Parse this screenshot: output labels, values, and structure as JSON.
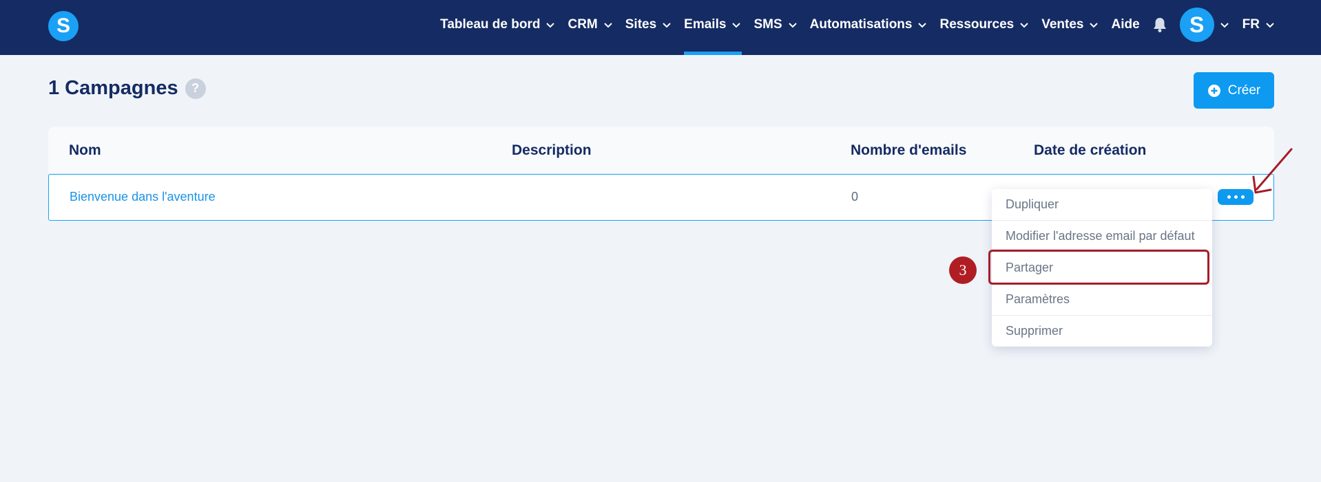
{
  "nav": {
    "logo_letter": "S",
    "items": [
      {
        "label": "Tableau de bord",
        "has_dropdown": true
      },
      {
        "label": "CRM",
        "has_dropdown": true
      },
      {
        "label": "Sites",
        "has_dropdown": true
      },
      {
        "label": "Emails",
        "has_dropdown": true,
        "active": true
      },
      {
        "label": "SMS",
        "has_dropdown": true
      },
      {
        "label": "Automatisations",
        "has_dropdown": true
      },
      {
        "label": "Ressources",
        "has_dropdown": true
      },
      {
        "label": "Ventes",
        "has_dropdown": true
      },
      {
        "label": "Aide",
        "has_dropdown": false
      }
    ],
    "avatar_letter": "S",
    "language": "FR"
  },
  "page": {
    "title": "1 Campagnes",
    "help_symbol": "?",
    "create_label": "Créer"
  },
  "table": {
    "columns": [
      "Nom",
      "Description",
      "Nombre d'emails",
      "Date de création"
    ],
    "rows": [
      {
        "name": "Bienvenue dans l'aventure",
        "description": "",
        "email_count": "0",
        "created": ""
      }
    ]
  },
  "menu": {
    "items": [
      "Dupliquer",
      "Modifier l'adresse email par défaut",
      "Partager",
      "Paramètres",
      "Supprimer"
    ],
    "highlighted_item": "Partager"
  },
  "annotation": {
    "step_number": "3"
  },
  "colors": {
    "navbar": "#152b63",
    "accent": "#1aa0f5",
    "button": "#0d9af0",
    "annotation_red": "#a51d28",
    "background": "#f0f4f9"
  }
}
